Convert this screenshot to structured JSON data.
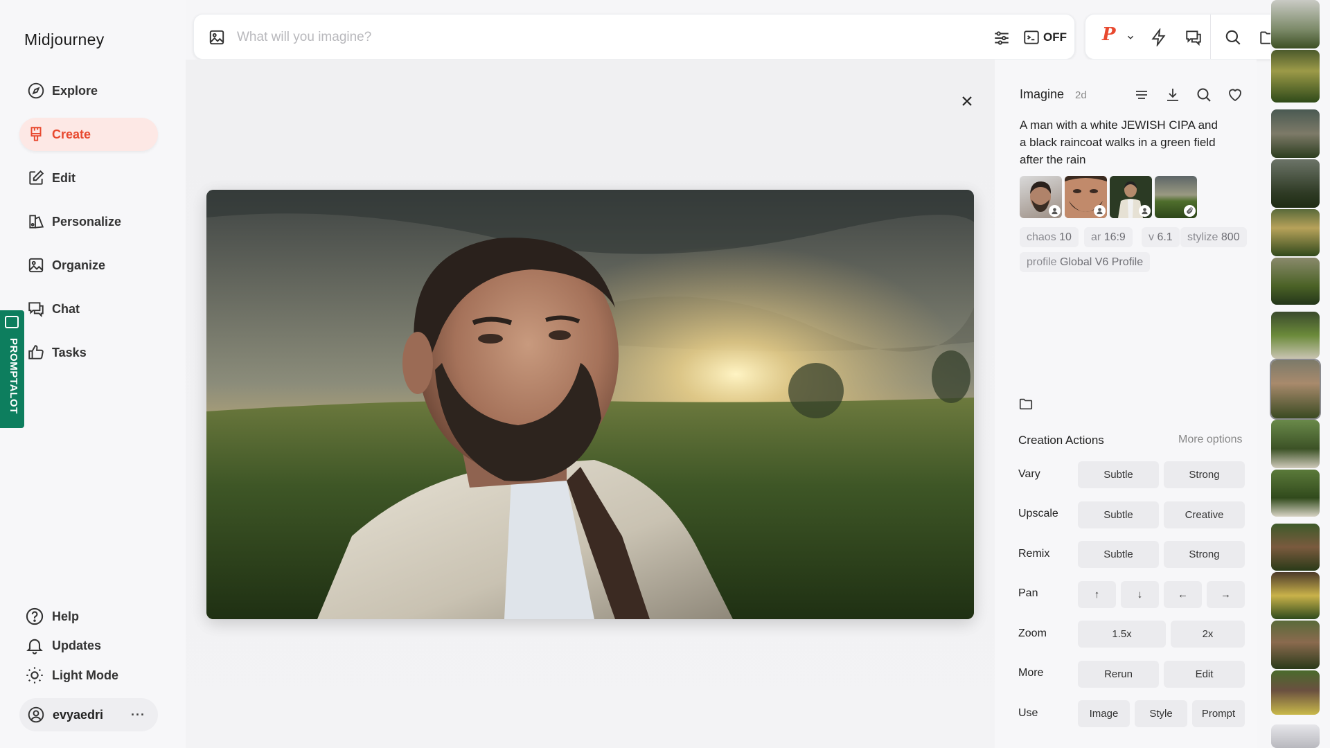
{
  "app": {
    "title": "Midjourney"
  },
  "sidebar": {
    "nav": [
      {
        "id": "explore",
        "label": "Explore",
        "icon": "compass-icon"
      },
      {
        "id": "create",
        "label": "Create",
        "icon": "brush-icon",
        "active": true
      },
      {
        "id": "edit",
        "label": "Edit",
        "icon": "edit-icon"
      },
      {
        "id": "personalize",
        "label": "Personalize",
        "icon": "personalize-icon"
      },
      {
        "id": "organize",
        "label": "Organize",
        "icon": "image-icon"
      },
      {
        "id": "chat",
        "label": "Chat",
        "icon": "chat-icon"
      },
      {
        "id": "tasks",
        "label": "Tasks",
        "icon": "thumbs-up-icon"
      }
    ],
    "bottom": [
      {
        "id": "help",
        "label": "Help",
        "icon": "help-icon"
      },
      {
        "id": "updates",
        "label": "Updates",
        "icon": "bell-icon"
      },
      {
        "id": "light-mode",
        "label": "Light Mode",
        "icon": "sun-icon"
      }
    ],
    "user": {
      "name": "evyaedri",
      "more": "···"
    }
  },
  "extension": {
    "label": "PROMPTALOT"
  },
  "prompt_bar": {
    "placeholder": "What will you imagine?",
    "raw_toggle": "OFF"
  },
  "toolbar": {
    "profile_letter": "P"
  },
  "detail": {
    "type": "Imagine",
    "age": "2d",
    "prompt": "A man with a white JEWISH CIPA and a black raincoat walks in a green field after the rain",
    "params": [
      {
        "label": "chaos",
        "value": "10"
      },
      {
        "label": "ar",
        "value": "16:9"
      },
      {
        "label": "v",
        "value": "6.1"
      },
      {
        "label": "stylize",
        "value": "800"
      },
      {
        "label": "profile",
        "value": "Global V6 Profile"
      }
    ],
    "creation_actions": {
      "title": "Creation Actions",
      "more": "More options",
      "rows": [
        {
          "label": "Vary",
          "buttons": [
            "Subtle",
            "Strong"
          ]
        },
        {
          "label": "Upscale",
          "buttons": [
            "Subtle",
            "Creative"
          ]
        },
        {
          "label": "Remix",
          "buttons": [
            "Subtle",
            "Strong"
          ]
        },
        {
          "label": "Pan",
          "buttons": [
            "↑",
            "↓",
            "←",
            "→"
          ]
        },
        {
          "label": "Zoom",
          "buttons": [
            "1.5x",
            "2x"
          ]
        },
        {
          "label": "More",
          "buttons": [
            "Rerun",
            "Edit"
          ]
        },
        {
          "label": "Use",
          "buttons": [
            "Image",
            "Style",
            "Prompt"
          ]
        }
      ]
    }
  },
  "colors": {
    "accent": "#e8492f",
    "active_bg": "#fde8e5",
    "extension": "#0d7e5e"
  }
}
